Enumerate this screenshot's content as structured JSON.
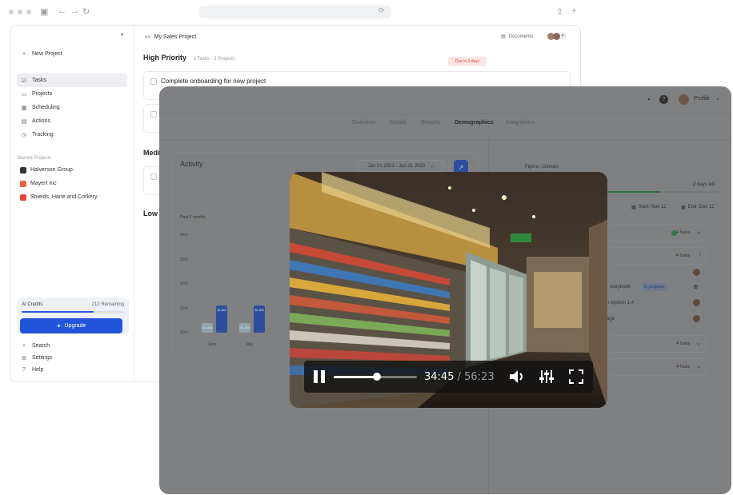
{
  "background_app": {
    "sidebar": {
      "new_project": "New Project",
      "nav": [
        {
          "label": "Tasks",
          "icon": "tasks-icon"
        },
        {
          "label": "Projects",
          "icon": "folder-icon"
        },
        {
          "label": "Scheduling",
          "icon": "calendar-icon"
        },
        {
          "label": "Actions",
          "icon": "actions-icon"
        },
        {
          "label": "Tracking",
          "icon": "tracking-icon"
        }
      ],
      "starred_header": "Starred Projects",
      "starred": [
        {
          "label": "Halverson Group",
          "color": "#333333"
        },
        {
          "label": "Mayert Inc",
          "color": "#e8643c"
        },
        {
          "label": "Shields, Hane and Corkery",
          "color": "#e0443c"
        }
      ],
      "credits": {
        "label": "AI Credits",
        "remaining": "212 Remaining",
        "level": 0.7
      },
      "upgrade": "Upgrade",
      "footer": [
        {
          "label": "Search",
          "icon": "search-icon"
        },
        {
          "label": "Settings",
          "icon": "gear-icon"
        },
        {
          "label": "Help",
          "icon": "help-icon"
        }
      ]
    },
    "main": {
      "project_title": "My Sales Project",
      "documents": "Documents",
      "avatar_count": "4",
      "high_priority": {
        "title": "High Priority",
        "sub": "3 Tasks · 2 Projects"
      },
      "task1": "Complete onboarding for new project",
      "task1_badge": "Due in 2 days",
      "medium_title": "Medi",
      "low_title": "Low"
    }
  },
  "overlay": {
    "profile": "Profile",
    "tabs": [
      "Overview",
      "Details",
      "Reports",
      "Demographics",
      "Integrations"
    ],
    "active_tab": "Demographics",
    "activity": {
      "title": "Activity",
      "date_range": "Jan 01 2021 - Jan 01 2023",
      "period": "Past 6 months"
    },
    "right_panel": {
      "project": "Figma - Devops",
      "days_left": "2 days left",
      "start": "Start: Nov 12",
      "end": "End: Dec 12",
      "progress": 0.68,
      "rows": [
        "4 Tasks",
        "4 Tasks",
        "4 Tasks",
        "4 Tasks"
      ],
      "storybook": "storybook",
      "in_progress": "In progress",
      "system": "n system 1.4",
      "page": "age"
    }
  },
  "chart_data": {
    "type": "bar",
    "period": "Past 6 months",
    "y_ticks": [
      "$4m",
      "$3m",
      "$2m",
      "$1m",
      "$0m"
    ],
    "ylim": [
      0,
      4
    ],
    "categories": [
      "June",
      "July"
    ],
    "series": [
      {
        "values": [
          0.4,
          0.4
        ],
        "labels": [
          "$1.4M",
          "$1.4M"
        ],
        "color": "#8fa3ad"
      },
      {
        "values": [
          1.1,
          1.1
        ],
        "labels": [
          "$1.6M",
          "$1.6M"
        ],
        "color": "#2c4e9c"
      }
    ]
  },
  "video_player": {
    "state": "playing",
    "current_time": "34:45",
    "separator": "/",
    "duration": "56:23",
    "progress": 0.52
  }
}
